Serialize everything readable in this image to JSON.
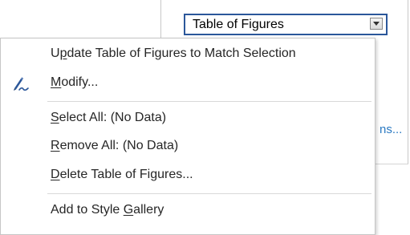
{
  "dialog": {
    "type_value": "Table of Figures",
    "link_fragment": "ns..."
  },
  "menu": {
    "items": [
      {
        "prefix": "U",
        "underline": "p",
        "rest": "date Table of Figures to Match Selection"
      },
      {
        "prefix": "",
        "underline": "M",
        "rest": "odify...",
        "icon": "pen-modify-icon"
      },
      {
        "prefix": "",
        "underline": "S",
        "rest": "elect All: (No Data)"
      },
      {
        "prefix": "",
        "underline": "R",
        "rest": "emove All: (No Data)"
      },
      {
        "prefix": "",
        "underline": "D",
        "rest": "elete Table of Figures..."
      },
      {
        "prefix": "Add to Style ",
        "underline": "G",
        "rest": "allery"
      }
    ]
  },
  "colors": {
    "accent": "#2b579a",
    "link": "#2b79c2",
    "text": "#262626"
  }
}
